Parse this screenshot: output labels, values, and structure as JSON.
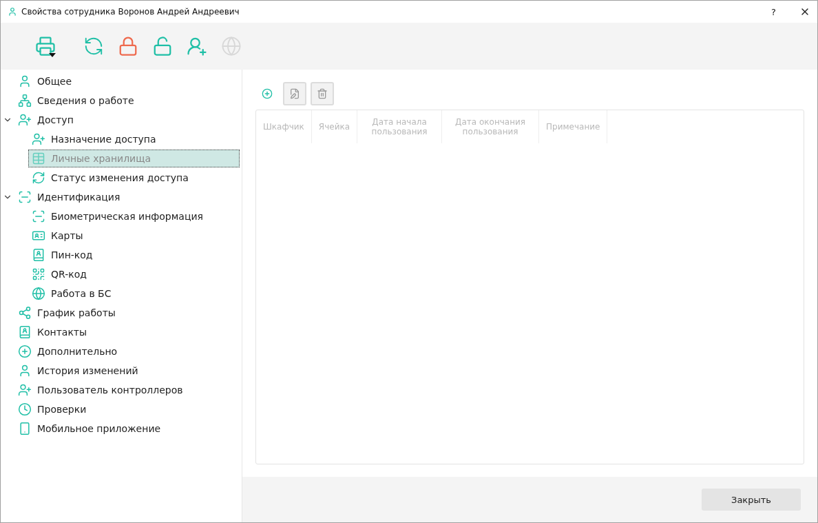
{
  "window": {
    "title": "Свойства сотрудника Воронов Андрей Андреевич",
    "help": "?"
  },
  "toolbar": [
    {
      "kind": "print",
      "disabled": false
    },
    {
      "kind": "sync",
      "disabled": false
    },
    {
      "kind": "lock",
      "disabled": false
    },
    {
      "kind": "unlock",
      "disabled": false
    },
    {
      "kind": "user",
      "disabled": false
    },
    {
      "kind": "globe",
      "disabled": true
    }
  ],
  "sidebar": {
    "items": [
      {
        "label": "Общее",
        "selected": false
      },
      {
        "label": "Сведения о работе",
        "selected": false
      },
      {
        "label": "Доступ",
        "selected": false,
        "expanded": true,
        "children": [
          {
            "label": "Назначение доступа",
            "selected": false
          },
          {
            "label": "Личные хранилища",
            "selected": true
          },
          {
            "label": "Статус изменения доступа",
            "selected": false
          }
        ]
      },
      {
        "label": "Идентификация",
        "selected": false,
        "expanded": true,
        "children": [
          {
            "label": "Биометрическая информация",
            "selected": false
          },
          {
            "label": "Карты",
            "selected": false
          },
          {
            "label": "Пин-код",
            "selected": false
          },
          {
            "label": "QR-код",
            "selected": false
          },
          {
            "label": "Работа в БС",
            "selected": false
          }
        ]
      },
      {
        "label": "График работы",
        "selected": false
      },
      {
        "label": "Контакты",
        "selected": false
      },
      {
        "label": "Дополнительно",
        "selected": false
      },
      {
        "label": "История изменений",
        "selected": false
      },
      {
        "label": "Пользователь контроллеров",
        "selected": false
      },
      {
        "label": "Проверки",
        "selected": false
      },
      {
        "label": "Мобильное приложение",
        "selected": false
      }
    ]
  },
  "actions": [
    {
      "kind": "add",
      "disabled": false
    },
    {
      "kind": "edit",
      "disabled": true
    },
    {
      "kind": "delete",
      "disabled": true
    }
  ],
  "table": {
    "columns": [
      "Шкафчик",
      "Ячейка",
      "Дата начала пользования",
      "Дата окончания пользования",
      "Примечание"
    ]
  },
  "footer": {
    "close_button": "Закрыть"
  }
}
